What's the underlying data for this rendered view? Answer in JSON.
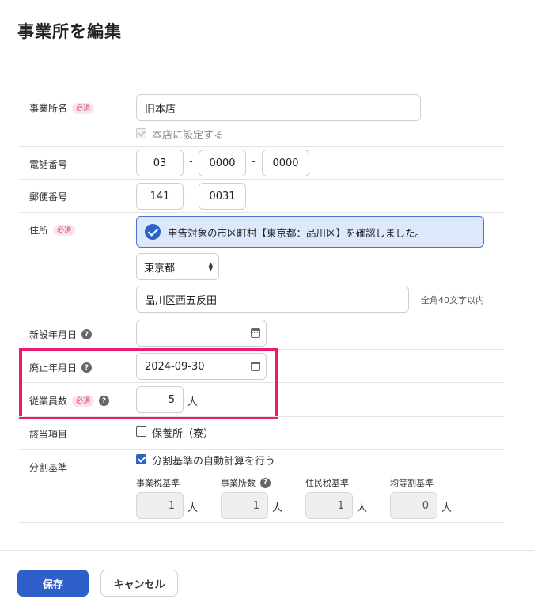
{
  "header": {
    "title": "事業所を編集"
  },
  "required_label": "必須",
  "fields": {
    "office_name": {
      "label": "事業所名",
      "value": "旧本店",
      "head_office_checkbox": "本店に設定する"
    },
    "phone": {
      "label": "電話番号",
      "part1": "03",
      "part2": "0000",
      "part3": "0000",
      "sep": "-"
    },
    "postal": {
      "label": "郵便番号",
      "part1": "141",
      "part2": "0031",
      "sep": "-"
    },
    "address": {
      "label": "住所",
      "notice": "申告対象の市区町村【東京都：品川区】を確認しました。",
      "prefecture": "東京都",
      "street": "品川区西五反田",
      "hint": "全角40文字以内"
    },
    "established_date": {
      "label": "新設年月日",
      "value": ""
    },
    "closed_date": {
      "label": "廃止年月日",
      "value": "2024-09-30"
    },
    "employees": {
      "label": "従業員数",
      "value": "5",
      "unit": "人"
    },
    "applicable": {
      "label": "該当項目",
      "checkbox": "保養所（寮）",
      "checked": false
    },
    "division": {
      "label": "分割基準",
      "auto_checkbox": "分割基準の自動計算を行う",
      "auto_checked": true,
      "columns": [
        {
          "label": "事業税基準",
          "value": "1",
          "unit": "人"
        },
        {
          "label": "事業所数",
          "value": "1",
          "unit": "人"
        },
        {
          "label": "住民税基準",
          "value": "1",
          "unit": "人"
        },
        {
          "label": "均等割基準",
          "value": "0",
          "unit": "人"
        }
      ]
    }
  },
  "help_glyph": "?",
  "footer": {
    "save_label": "保存",
    "cancel_label": "キャンセル"
  },
  "colors": {
    "primary": "#2f5fc8",
    "highlight": "#ec1b72",
    "notice_bg": "#dde8fb"
  }
}
